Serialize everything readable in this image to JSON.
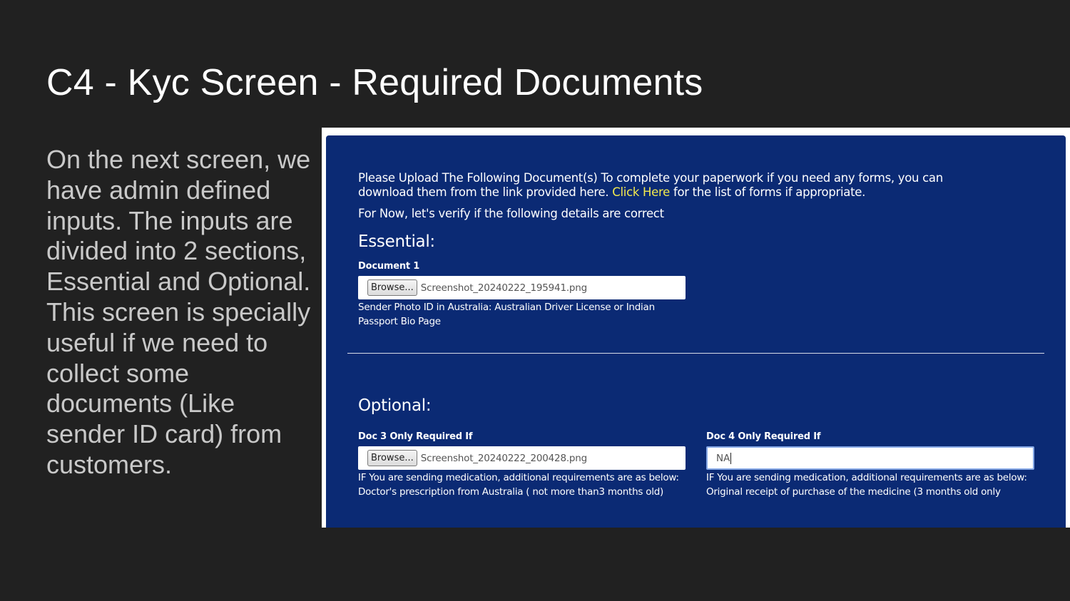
{
  "slide": {
    "title": "C4 - Kyc Screen - Required Documents",
    "description": "On the next screen, we have admin defined inputs. The inputs are divided into 2 sections, Essential and Optional. This screen is specially useful if we need to collect some documents (Like sender ID card) from customers."
  },
  "form": {
    "intro_text": "Please Upload The Following Document(s) To complete your paperwork if you need any forms, you can download them from the link provided here.",
    "link_text": "Click Here",
    "intro_suffix": "for the list of forms if appropriate.",
    "verify_text": "For Now, let's verify if the following details are correct",
    "essential": {
      "title": "Essential:",
      "document1": {
        "label": "Document 1",
        "browse_label": "Browse...",
        "file_name": "Screenshot_20240222_195941.png",
        "help_line1": "Sender Photo ID in Australia: Australian Driver License or Indian",
        "help_line2": "Passport Bio Page"
      }
    },
    "optional": {
      "title": "Optional:",
      "doc3": {
        "label": "Doc 3 Only Required If",
        "browse_label": "Browse...",
        "file_name": "Screenshot_20240222_200428.png",
        "help_line1": "IF You are sending medication, additional requirements are as below:",
        "help_line2": "Doctor's prescription from Australia ( not more than3 months old)"
      },
      "doc4": {
        "label": "Doc 4 Only Required If",
        "value": "NA",
        "help_line1": "IF You are sending medication, additional requirements are as below:",
        "help_line2": "Original receipt of purchase of the medicine (3 months old only"
      }
    }
  },
  "colors": {
    "slide_background": "#212121",
    "panel_background": "#0b2a74",
    "link": "#f2e94e"
  }
}
